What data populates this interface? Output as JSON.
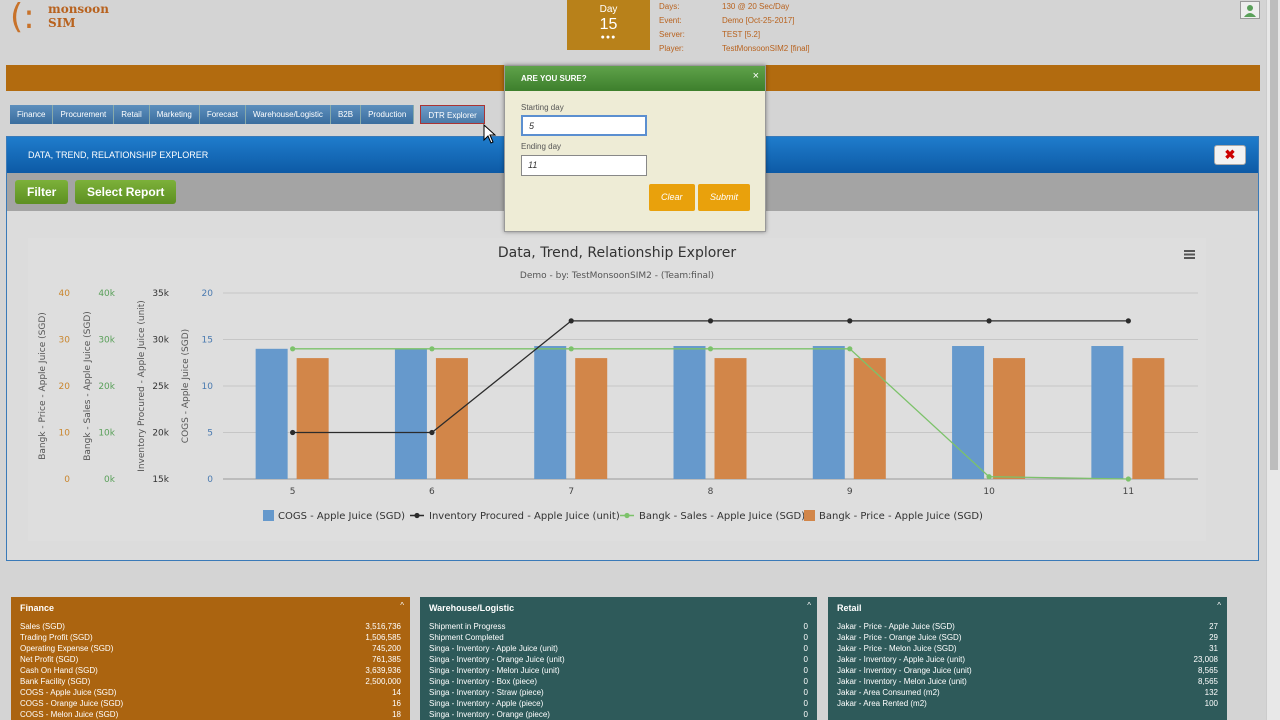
{
  "header": {
    "logo_line1": "monsoon",
    "logo_line2": "SIM",
    "day_label": "Day",
    "day_number": "15",
    "day_dots": "●●●",
    "info": [
      {
        "key": "Days:",
        "value": "130 @ 20 Sec/Day"
      },
      {
        "key": "Event:",
        "value": "Demo [Oct-25-2017]"
      },
      {
        "key": "Server:",
        "value": "TEST [5.2]"
      },
      {
        "key": "Player:",
        "value": "TestMonsoonSIM2 [final]"
      }
    ]
  },
  "tabs": [
    "Finance",
    "Procurement",
    "Retail",
    "Marketing",
    "Forecast",
    "Warehouse/Logistic",
    "B2B",
    "Production",
    "DTR Explorer"
  ],
  "panel": {
    "title": "DATA, TREND, RELATIONSHIP EXPLORER",
    "filter_label": "Filter",
    "report_label": "Select Report"
  },
  "modal": {
    "title": "ARE YOU SURE?",
    "close": "×",
    "start_label": "Starting day",
    "start_value": "5",
    "end_label": "Ending day",
    "end_value": "11",
    "clear_label": "Clear",
    "submit_label": "Submit"
  },
  "colors": {
    "cogs": "#6699cc",
    "inventory": "#2b2b2b",
    "sales": "#7cc26a",
    "price": "#d28649"
  },
  "chart_data": {
    "type": "bar",
    "title": "Data, Trend, Relationship Explorer",
    "subtitle": "Demo - by: TestMonsoonSIM2 - (Team:final)",
    "categories": [
      "5",
      "6",
      "7",
      "8",
      "9",
      "10",
      "11"
    ],
    "series": [
      {
        "name": "COGS - Apple Juice (SGD)",
        "type": "bar",
        "axis": "COGS - Apple Juice (SGD)",
        "values": [
          14,
          14,
          14.3,
          14.3,
          14.3,
          14.3,
          14.3
        ]
      },
      {
        "name": "Inventory Procured - Apple Juice (unit)",
        "type": "line",
        "axis": "Inventory Procured - Apple Juice (unit)",
        "values": [
          20000,
          20000,
          32000,
          32000,
          32000,
          32000,
          32000
        ]
      },
      {
        "name": "Bangk - Sales - Apple Juice (SGD)",
        "type": "line",
        "axis": "Bangk - Sales - Apple Juice (SGD)",
        "values": [
          28000,
          28000,
          28000,
          28000,
          28000,
          500,
          0
        ]
      },
      {
        "name": "Bangk - Price - Apple Juice (SGD)",
        "type": "bar",
        "axis": "Bangk - Price - Apple Juice (SGD)",
        "values": [
          26,
          26,
          26,
          26,
          26,
          26,
          26
        ]
      }
    ],
    "axes": [
      {
        "label": "Bangk - Price - Apple Juice (SGD)",
        "ticks": [
          "0",
          "10",
          "20",
          "30",
          "40"
        ],
        "ylim": [
          0,
          40
        ]
      },
      {
        "label": "Bangk - Sales - Apple Juice (SGD)",
        "ticks": [
          "0k",
          "10k",
          "20k",
          "30k",
          "40k"
        ],
        "ylim": [
          0,
          40000
        ]
      },
      {
        "label": "Inventory Procured - Apple Juice (unit)",
        "ticks": [
          "15k",
          "20k",
          "25k",
          "30k",
          "35k"
        ],
        "ylim": [
          15000,
          35000
        ]
      },
      {
        "label": "COGS - Apple Juice (SGD)",
        "ticks": [
          "0",
          "5",
          "10",
          "15",
          "20"
        ],
        "ylim": [
          0,
          20
        ]
      }
    ],
    "legend": "bottom",
    "grid": true
  },
  "boxes": {
    "finance": {
      "title": "Finance",
      "rows": [
        {
          "label": "Sales (SGD)",
          "value": "3,516,736"
        },
        {
          "label": "Trading Profit (SGD)",
          "value": "1,506,585"
        },
        {
          "label": "Operating Expense (SGD)",
          "value": "745,200"
        },
        {
          "label": "Net Profit (SGD)",
          "value": "761,385"
        },
        {
          "label": "Cash On Hand (SGD)",
          "value": "3,639,936"
        },
        {
          "label": "Bank Facility (SGD)",
          "value": "2,500,000"
        },
        {
          "label": "COGS - Apple Juice (SGD)",
          "value": "14"
        },
        {
          "label": "COGS - Orange Juice (SGD)",
          "value": "16"
        },
        {
          "label": "COGS - Melon Juice (SGD)",
          "value": "18"
        }
      ]
    },
    "warehouse": {
      "title": "Warehouse/Logistic",
      "rows": [
        {
          "label": "Shipment in Progress",
          "value": "0"
        },
        {
          "label": "Shipment Completed",
          "value": "0"
        },
        {
          "label": "Singa - Inventory - Apple Juice (unit)",
          "value": "0"
        },
        {
          "label": "Singa - Inventory - Orange Juice (unit)",
          "value": "0"
        },
        {
          "label": "Singa - Inventory - Melon Juice (unit)",
          "value": "0"
        },
        {
          "label": "Singa - Inventory - Box (piece)",
          "value": "0"
        },
        {
          "label": "Singa - Inventory - Straw (piece)",
          "value": "0"
        },
        {
          "label": "Singa - Inventory - Apple (piece)",
          "value": "0"
        },
        {
          "label": "Singa - Inventory - Orange (piece)",
          "value": "0"
        }
      ]
    },
    "retail": {
      "title": "Retail",
      "rows": [
        {
          "label": "Jakar - Price - Apple Juice (SGD)",
          "value": "27"
        },
        {
          "label": "Jakar - Price - Orange Juice (SGD)",
          "value": "29"
        },
        {
          "label": "Jakar - Price - Melon Juice (SGD)",
          "value": "31"
        },
        {
          "label": "Jakar - Inventory - Apple Juice (unit)",
          "value": "23,008"
        },
        {
          "label": "Jakar - Inventory - Orange Juice (unit)",
          "value": "8,565"
        },
        {
          "label": "Jakar - Inventory - Melon Juice (unit)",
          "value": "8,565"
        },
        {
          "label": "Jakar - Area Consumed (m2)",
          "value": "132"
        },
        {
          "label": "Jakar - Area Rented (m2)",
          "value": "100"
        }
      ]
    }
  }
}
